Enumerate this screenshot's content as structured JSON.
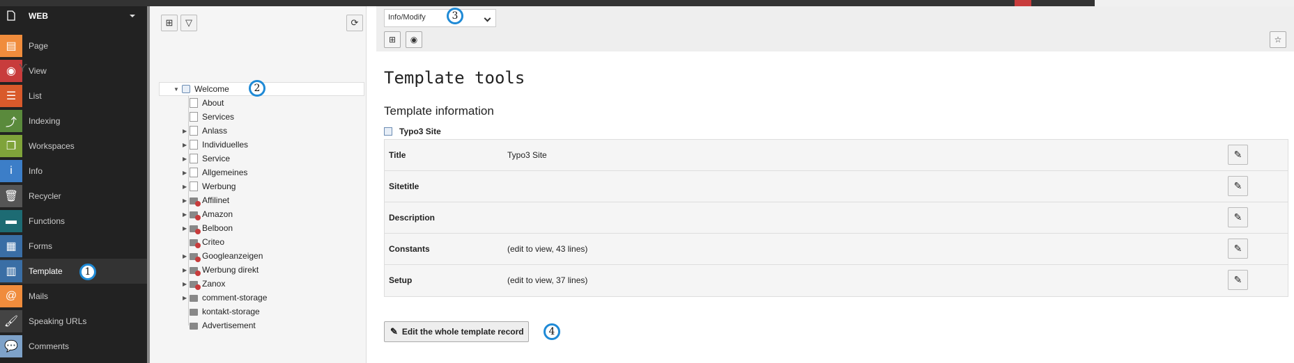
{
  "module_menu": {
    "group_label": "WEB",
    "items": [
      {
        "label": "Page",
        "icon": "page-module-icon",
        "color": "#f08c3c",
        "glyph": "▤"
      },
      {
        "label": "View",
        "icon": "view-module-icon",
        "color": "#c83c3c",
        "glyph": "◉"
      },
      {
        "label": "List",
        "icon": "list-module-icon",
        "color": "#d95a2b",
        "glyph": "☰"
      },
      {
        "label": "Indexing",
        "icon": "indexing-module-icon",
        "color": "#5a8a3c",
        "glyph": "⤴"
      },
      {
        "label": "Workspaces",
        "icon": "workspaces-module-icon",
        "color": "#7fa33a",
        "glyph": "❐"
      },
      {
        "label": "Info",
        "icon": "info-module-icon",
        "color": "#3c7ec8",
        "glyph": "i"
      },
      {
        "label": "Recycler",
        "icon": "recycler-module-icon",
        "color": "#555555",
        "glyph": "🗑"
      },
      {
        "label": "Functions",
        "icon": "functions-module-icon",
        "color": "#1d6b73",
        "glyph": "▬"
      },
      {
        "label": "Forms",
        "icon": "forms-module-icon",
        "color": "#3a6ea5",
        "glyph": "▦"
      },
      {
        "label": "Template",
        "icon": "template-module-icon",
        "color": "#3a6ea5",
        "glyph": "▥"
      },
      {
        "label": "Mails",
        "icon": "mails-module-icon",
        "color": "#f08c3c",
        "glyph": "@"
      },
      {
        "label": "Speaking URLs",
        "icon": "speaking-urls-module-icon",
        "color": "#444444",
        "glyph": "🖌"
      },
      {
        "label": "Comments",
        "icon": "comments-module-icon",
        "color": "#7ea2c9",
        "glyph": "💬"
      }
    ],
    "active": "Template"
  },
  "page_tree": {
    "root": {
      "label": "Welcome"
    },
    "children": [
      {
        "label": "About",
        "type": "page",
        "expandable": false
      },
      {
        "label": "Services",
        "type": "page",
        "expandable": false
      },
      {
        "label": "Anlass",
        "type": "page",
        "expandable": true
      },
      {
        "label": "Individuelles",
        "type": "page",
        "expandable": true
      },
      {
        "label": "Service",
        "type": "page",
        "expandable": true
      },
      {
        "label": "Allgemeines",
        "type": "page",
        "expandable": true
      },
      {
        "label": "Werbung",
        "type": "page",
        "expandable": true
      },
      {
        "label": "Affilinet",
        "type": "folder-hidden",
        "expandable": true
      },
      {
        "label": "Amazon",
        "type": "folder-hidden",
        "expandable": true
      },
      {
        "label": "Belboon",
        "type": "folder-hidden",
        "expandable": true
      },
      {
        "label": "Criteo",
        "type": "folder-hidden",
        "expandable": false
      },
      {
        "label": "Googleanzeigen",
        "type": "folder-hidden",
        "expandable": true
      },
      {
        "label": "Werbung direkt",
        "type": "folder-hidden",
        "expandable": true
      },
      {
        "label": "Zanox",
        "type": "folder-hidden",
        "expandable": true
      },
      {
        "label": "comment-storage",
        "type": "folder",
        "expandable": true
      },
      {
        "label": "kontakt-storage",
        "type": "folder",
        "expandable": false
      },
      {
        "label": "Advertisement",
        "type": "folder",
        "expandable": false
      }
    ]
  },
  "docheader": {
    "function_select": "Info/Modify"
  },
  "content": {
    "title": "Template tools",
    "subtitle": "Template information",
    "record_title": "Typo3 Site",
    "rows": [
      {
        "label": "Title",
        "value": "Typo3 Site"
      },
      {
        "label": "Sitetitle",
        "value": ""
      },
      {
        "label": "Description",
        "value": ""
      },
      {
        "label": "Constants",
        "value": "(edit to view, 43 lines)"
      },
      {
        "label": "Setup",
        "value": "(edit to view, 37 lines)"
      }
    ],
    "edit_whole_label": "Edit the whole template record"
  },
  "callouts": [
    "1",
    "2",
    "3",
    "4"
  ]
}
